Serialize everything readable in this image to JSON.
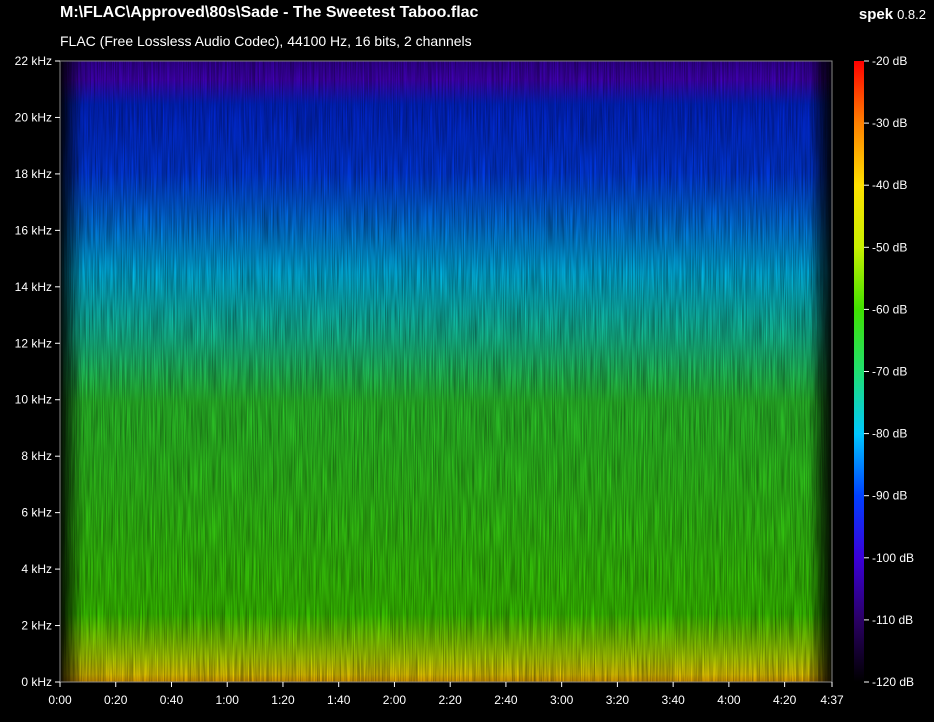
{
  "header": {
    "file_path": "M:\\FLAC\\Approved\\80s\\Sade - The Sweetest Taboo.flac",
    "info": "FLAC (Free Lossless Audio Codec), 44100 Hz, 16 bits, 2 channels",
    "app_name": "spek",
    "app_version": "0.8.2"
  },
  "chart_data": {
    "type": "heatmap",
    "x_ticks": [
      "0:00",
      "0:20",
      "0:40",
      "1:00",
      "1:20",
      "1:40",
      "2:00",
      "2:20",
      "2:40",
      "3:00",
      "3:20",
      "3:40",
      "4:00",
      "4:20",
      "4:37"
    ],
    "x_tick_seconds": [
      0,
      20,
      40,
      60,
      80,
      100,
      120,
      140,
      160,
      180,
      200,
      220,
      240,
      260,
      277
    ],
    "x_range_seconds": [
      0,
      277
    ],
    "y_ticks": [
      "0 kHz",
      "2 kHz",
      "4 kHz",
      "6 kHz",
      "8 kHz",
      "10 kHz",
      "12 kHz",
      "14 kHz",
      "16 kHz",
      "18 kHz",
      "20 kHz",
      "22 kHz"
    ],
    "y_tick_values_khz": [
      0,
      2,
      4,
      6,
      8,
      10,
      12,
      14,
      16,
      18,
      20,
      22
    ],
    "y_range_khz": [
      0,
      22
    ],
    "colorbar_ticks": [
      "-20 dB",
      "-30 dB",
      "-40 dB",
      "-50 dB",
      "-60 dB",
      "-70 dB",
      "-80 dB",
      "-90 dB",
      "-100 dB",
      "-110 dB",
      "-120 dB"
    ],
    "colorbar_values_db": [
      -20,
      -30,
      -40,
      -50,
      -60,
      -70,
      -80,
      -90,
      -100,
      -110,
      -120
    ],
    "colorbar_range_db": [
      -120,
      -20
    ],
    "colors": {
      "minus_120": "#000000",
      "minus_110": "#2a0064",
      "minus_100": "#3a00d8",
      "minus_90": "#0040ff",
      "minus_80": "#00c8ff",
      "minus_70": "#20e070",
      "minus_60": "#40e000",
      "minus_50": "#c8f000",
      "minus_40": "#ffe000",
      "minus_30": "#ff8000",
      "minus_20": "#ff0000"
    }
  }
}
